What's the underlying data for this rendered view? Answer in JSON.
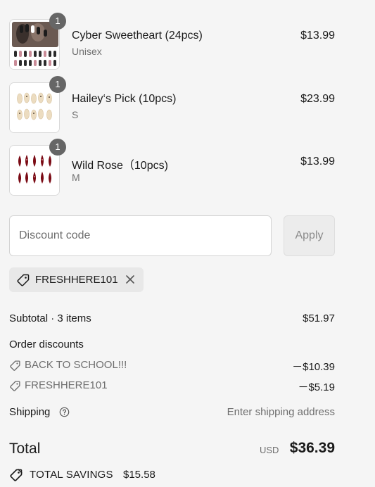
{
  "line_items": [
    {
      "quantity": "1",
      "name": "Cyber Sweetheart (24pcs)",
      "variant": "Unisex",
      "price": "$13.99",
      "thumbnail_icon": "black-chrome-press-on-nails-image"
    },
    {
      "quantity": "1",
      "name": "Hailey‘s Pick (10pcs)",
      "variant": "S",
      "price": "$23.99",
      "thumbnail_icon": "glazed-nude-press-on-nails-image"
    },
    {
      "quantity": "1",
      "name": "Wild Rose（10pcs)",
      "variant": "M",
      "price": "$13.99",
      "thumbnail_icon": "dark-red-press-on-nails-image"
    }
  ],
  "discount": {
    "placeholder": "Discount code",
    "apply_label": "Apply",
    "applied_code": "FRESHHERE101"
  },
  "summary": {
    "subtotal_label": "Subtotal · 3 items",
    "subtotal_value": "$51.97",
    "order_discounts_label": "Order discounts",
    "discounts": [
      {
        "name": "BACK TO SCHOOL!!!",
        "amount": "－$10.39"
      },
      {
        "name": "FRESHHERE101",
        "amount": "－$5.19"
      }
    ],
    "shipping_label": "Shipping",
    "shipping_value": "Enter shipping address",
    "total_label": "Total",
    "currency": "USD",
    "total_value": "$36.39",
    "savings_label": "TOTAL SAVINGS",
    "savings_value": "$15.58"
  },
  "colors": {
    "page_bg": "#f5f5f5",
    "badge": "#666666",
    "muted_text": "#6e6e6e",
    "nail_black": "#1c1c1c",
    "nail_nude": "#ecdcc0",
    "nail_red": "#7a0a14"
  }
}
